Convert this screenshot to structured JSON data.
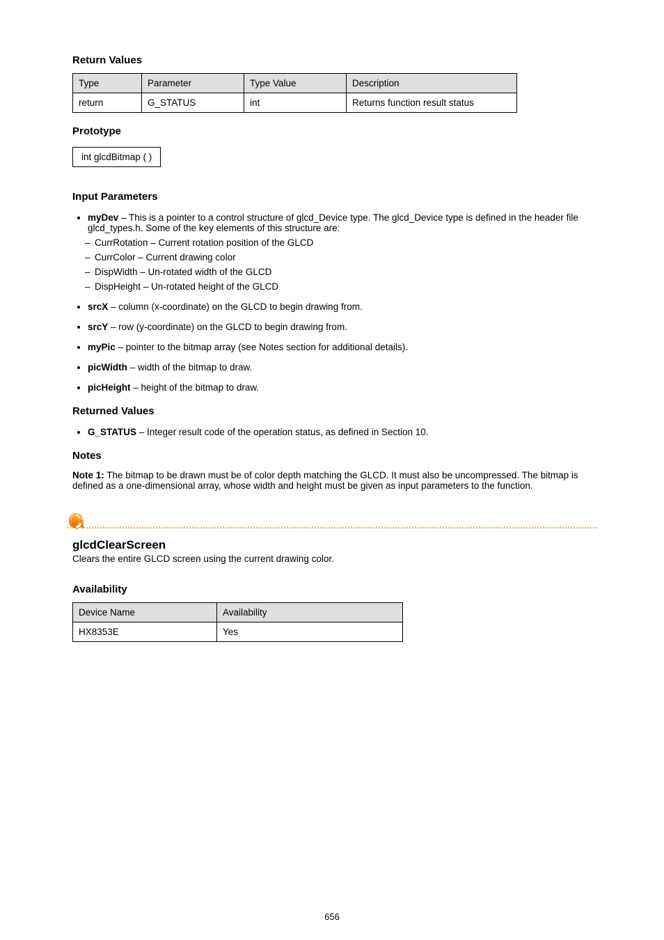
{
  "sections": {
    "returnValues": {
      "heading": "Return Values",
      "table": {
        "headers": [
          "Type",
          "Parameter",
          "Type Value",
          "Description"
        ],
        "row": [
          "return",
          "G_STATUS",
          "int",
          "Returns function result status"
        ]
      }
    },
    "prototype": {
      "heading": "Prototype",
      "code": "int glcdBitmap (\n)"
    },
    "inputParams": {
      "heading": "Input Parameters",
      "items": [
        {
          "name": "myDev",
          "desc": " – This is a pointer to a control structure of glcd_Device type. The glcd_Device type is defined in the header file glcd_types.h. Some of the key elements of this structure are:",
          "sub": [
            "CurrRotation – Current rotation position of the GLCD",
            "CurrColor – Current drawing color",
            "DispWidth – Un-rotated width of the GLCD",
            "DispHeight – Un-rotated height of the GLCD"
          ]
        },
        {
          "name": "srcX",
          "desc": " – column (x-coordinate) on the GLCD to begin drawing from."
        },
        {
          "name": "srcY",
          "desc": " – row (y-coordinate) on the GLCD to begin drawing from."
        },
        {
          "name": "myPic",
          "desc": " – pointer to the bitmap array (see Notes section for additional details)."
        },
        {
          "name": "picWidth",
          "desc": " – width of the bitmap to draw."
        },
        {
          "name": "picHeight",
          "desc": " – height of the bitmap to draw."
        }
      ]
    },
    "returnedValues": {
      "heading": "Returned Values",
      "items": [
        {
          "name": "G_STATUS",
          "desc": " – Integer result code of the operation status, as defined in Section 10."
        }
      ]
    },
    "notes": {
      "heading": "Notes",
      "label": "Note 1:",
      "body": " The bitmap to be drawn must be of color depth matching the GLCD. It must also be uncompressed. The bitmap is defined as a one-dimensional array, whose width and height must be given as input parameters to the function."
    }
  },
  "function": {
    "title": "glcdClearScreen",
    "desc": "Clears the entire GLCD screen using the current drawing color.",
    "availability": {
      "heading": "Availability",
      "table": {
        "headers": [
          "Device Name",
          "Availability"
        ],
        "row": [
          "HX8353E",
          "Yes"
        ]
      }
    }
  },
  "pageNumber": "656"
}
